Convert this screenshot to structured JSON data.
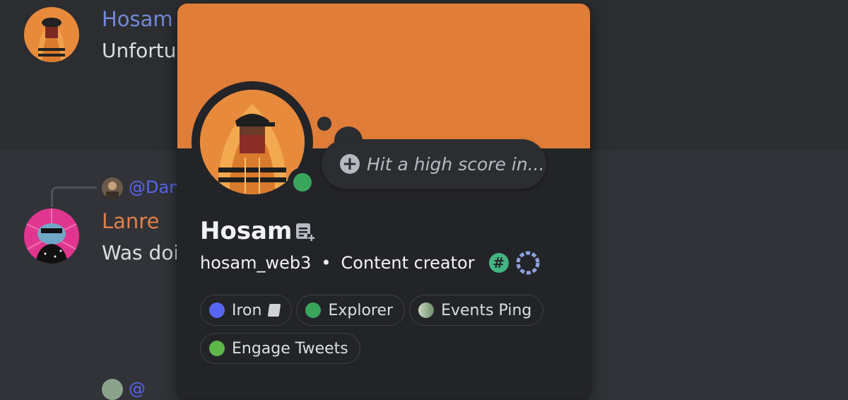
{
  "chat": {
    "msg1": {
      "author": "Hosam",
      "text": "Unfortu",
      "author_color": "#7289da"
    },
    "reply": {
      "mention": "@Dan"
    },
    "msg2": {
      "author": "Lanre",
      "text": "Was doir",
      "author_color": "#e0804a"
    },
    "reply2": {
      "mention": "@"
    }
  },
  "popout": {
    "banner_color": "#e07d38",
    "status_bubble_text": "Hit a high score in...",
    "display_name": "Hosam",
    "username": "hosam_web3",
    "separator": "•",
    "pronoun_or_tagline": "Content creator",
    "status": "online",
    "badges": [
      "hashtag-badge",
      "wreath-badge"
    ],
    "roles": [
      {
        "label": "Iron",
        "color": "#5865f2",
        "emoji": true
      },
      {
        "label": "Explorer",
        "color": "#3ba55c"
      },
      {
        "label": "Events Ping",
        "color": "#9aae96"
      },
      {
        "label": "Engage Tweets",
        "color": "#5db84a"
      }
    ]
  }
}
